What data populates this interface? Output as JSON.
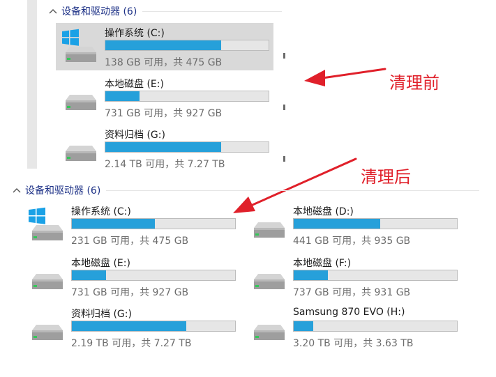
{
  "before": {
    "group_title": "设备和驱动器 (6)",
    "drives": [
      {
        "name": "操作系统 (C:)",
        "info": "138 GB 可用，共 475 GB",
        "used_fraction": 0.71,
        "icon": "windows-drive-icon"
      },
      {
        "name": "本地磁盘 (E:)",
        "info": "731 GB 可用，共 927 GB",
        "used_fraction": 0.21,
        "icon": "hard-drive-icon"
      },
      {
        "name": "资料归档 (G:)",
        "info": "2.14 TB 可用，共 7.27 TB",
        "used_fraction": 0.71,
        "icon": "hard-drive-icon"
      }
    ]
  },
  "after": {
    "group_title": "设备和驱动器 (6)",
    "drives_left": [
      {
        "name": "操作系统 (C:)",
        "info": "231 GB 可用，共 475 GB",
        "used_fraction": 0.51,
        "icon": "windows-drive-icon"
      },
      {
        "name": "本地磁盘 (E:)",
        "info": "731 GB 可用，共 927 GB",
        "used_fraction": 0.21,
        "icon": "hard-drive-icon"
      },
      {
        "name": "资料归档 (G:)",
        "info": "2.19 TB 可用，共 7.27 TB",
        "used_fraction": 0.7,
        "icon": "hard-drive-icon"
      }
    ],
    "drives_right": [
      {
        "name": "本地磁盘 (D:)",
        "info": "441 GB 可用，共 935 GB",
        "used_fraction": 0.53,
        "icon": "hard-drive-icon"
      },
      {
        "name": "本地磁盘 (F:)",
        "info": "737 GB 可用，共 931 GB",
        "used_fraction": 0.21,
        "icon": "hard-drive-icon"
      },
      {
        "name": "Samsung 870 EVO (H:)",
        "info": "3.20 TB 可用，共 3.63 TB",
        "used_fraction": 0.12,
        "icon": "hard-drive-icon"
      }
    ]
  },
  "annotations": {
    "before_label": "清理前",
    "after_label": "清理后"
  },
  "colors": {
    "bar_fill": "#26a0da",
    "bar_track": "#e6e6e6",
    "annotation_red": "#e0202a",
    "group_title": "#1e3287"
  }
}
